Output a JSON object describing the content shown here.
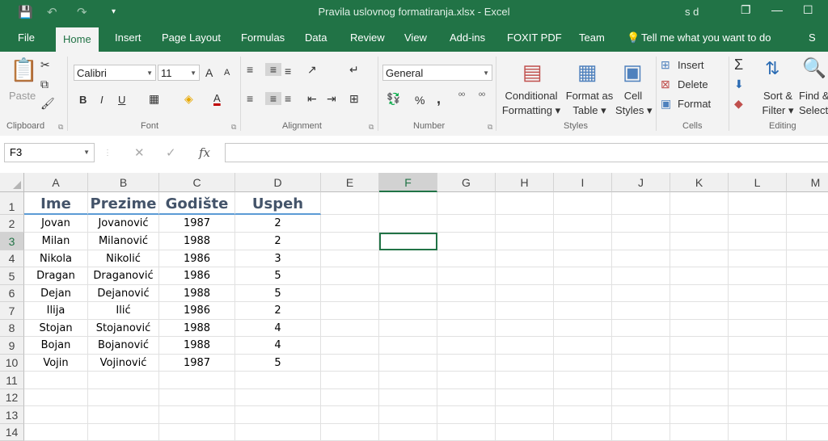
{
  "title": "Pravila uslovnog formatiranja.xlsx  -  Excel",
  "user": "s d",
  "qat": {
    "save": "💾",
    "undo": "↶",
    "redo": "↷",
    "customize": "▾"
  },
  "window_controls": {
    "restore": "❐",
    "minimize": "—",
    "maximize": "☐",
    "close": "✕"
  },
  "tabs": [
    "File",
    "Home",
    "Insert",
    "Page Layout",
    "Formulas",
    "Data",
    "Review",
    "View",
    "Add-ins",
    "FOXIT PDF",
    "Team"
  ],
  "active_tab": "Home",
  "tell_me": "Tell me what you want to do",
  "share": "S",
  "ribbon": {
    "clipboard": {
      "label": "Clipboard",
      "paste": "Paste"
    },
    "font": {
      "label": "Font",
      "name": "Calibri",
      "size": "11",
      "bold": "B",
      "italic": "I",
      "underline": "U",
      "grow": "A",
      "shrink": "A",
      "fill_letter": "A"
    },
    "alignment": {
      "label": "Alignment"
    },
    "number": {
      "label": "Number",
      "format": "General",
      "percent": "%",
      "comma": ","
    },
    "styles": {
      "label": "Styles",
      "conditional_1": "Conditional",
      "conditional_2": "Formatting",
      "table_1": "Format as",
      "table_2": "Table",
      "cell_1": "Cell",
      "cell_2": "Styles"
    },
    "cells": {
      "label": "Cells",
      "insert": "Insert",
      "delete": "Delete",
      "format": "Format"
    },
    "editing": {
      "label": "Editing",
      "sum": "Σ",
      "sort_1": "Sort &",
      "sort_2": "Filter",
      "find_1": "Find &",
      "find_2": "Select"
    }
  },
  "formula_bar": {
    "name_box": "F3",
    "fx": "fx",
    "cancel": "✕",
    "enter": "✓",
    "value": ""
  },
  "columns": [
    "A",
    "B",
    "C",
    "D",
    "E",
    "F",
    "G",
    "H",
    "I",
    "J",
    "K",
    "L",
    "M"
  ],
  "selected_column": "F",
  "selected_row": "3",
  "rows": [
    "1",
    "2",
    "3",
    "4",
    "5",
    "6",
    "7",
    "8",
    "9",
    "10",
    "11",
    "12",
    "13",
    "14"
  ],
  "headers": [
    "Ime",
    "Prezime",
    "Godište",
    "Uspeh"
  ],
  "data": [
    [
      "Jovan",
      "Jovanović",
      "1987",
      "2"
    ],
    [
      "Milan",
      "Milanović",
      "1988",
      "2"
    ],
    [
      "Nikola",
      "Nikolić",
      "1986",
      "3"
    ],
    [
      "Dragan",
      "Draganović",
      "1986",
      "5"
    ],
    [
      "Dejan",
      "Dejanović",
      "1988",
      "5"
    ],
    [
      "Ilija",
      "Ilić",
      "1986",
      "2"
    ],
    [
      "Stojan",
      "Stojanović",
      "1988",
      "4"
    ],
    [
      "Bojan",
      "Bojanović",
      "1988",
      "4"
    ],
    [
      "Vojin",
      "Vojinović",
      "1987",
      "5"
    ]
  ]
}
